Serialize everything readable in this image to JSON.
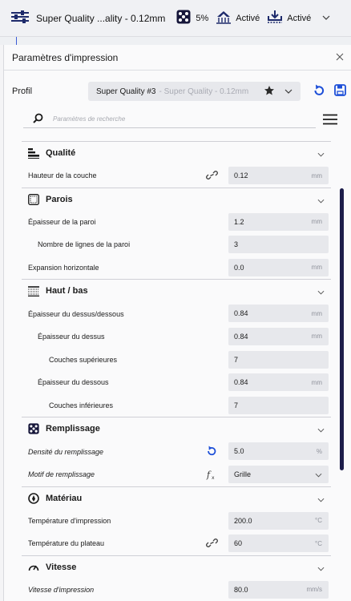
{
  "header": {
    "profile_summary": "Super Quality ...ality - 0.12mm",
    "infill_value": "5%",
    "support_status": "Activé",
    "adhesion_status": "Activé",
    "icons": [
      "settings-sliders-icon",
      "infill-icon",
      "support-icon",
      "adhesion-icon",
      "chevron-down-icon"
    ]
  },
  "panel": {
    "title": "Paramètres d'impression",
    "profile_label": "Profil",
    "profile_name": "Super Quality #3",
    "profile_detail": "- Super Quality - 0.12mm",
    "search_placeholder": "Paramètres de recherche"
  },
  "colors": {
    "accent": "#1d4fd8",
    "scrollbar": "#1c1c4a"
  },
  "sections": [
    {
      "name": "Qualité",
      "icon": "quality-icon",
      "rows": [
        {
          "label": "Hauteur de la couche",
          "value": "0.12",
          "unit": "mm",
          "indent": 0,
          "action": "link-icon"
        }
      ]
    },
    {
      "name": "Parois",
      "icon": "walls-icon",
      "rows": [
        {
          "label": "Épaisseur de la paroi",
          "value": "1.2",
          "unit": "mm",
          "indent": 0
        },
        {
          "label": "Nombre de lignes de la paroi",
          "value": "3",
          "unit": "",
          "indent": 1
        },
        {
          "label": "Expansion horizontale",
          "value": "0.0",
          "unit": "mm",
          "indent": 0
        }
      ]
    },
    {
      "name": "Haut / bas",
      "icon": "top-bottom-icon",
      "rows": [
        {
          "label": "Épaisseur du dessus/dessous",
          "value": "0.84",
          "unit": "mm",
          "indent": 0
        },
        {
          "label": "Épaisseur du dessus",
          "value": "0.84",
          "unit": "mm",
          "indent": 1
        },
        {
          "label": "Couches supérieures",
          "value": "7",
          "unit": "",
          "indent": 2
        },
        {
          "label": "Épaisseur du dessous",
          "value": "0.84",
          "unit": "mm",
          "indent": 1
        },
        {
          "label": "Couches inférieures",
          "value": "7",
          "unit": "",
          "indent": 2
        }
      ]
    },
    {
      "name": "Remplissage",
      "icon": "infill-icon",
      "rows": [
        {
          "label": "Densité du remplissage",
          "value": "5.0",
          "unit": "%",
          "indent": 0,
          "italic": true,
          "action": "reset-icon"
        },
        {
          "label": "Motif de remplissage",
          "value": "Grille",
          "unit": "",
          "indent": 0,
          "italic": true,
          "action": "function-icon",
          "dropdown": true
        }
      ]
    },
    {
      "name": "Matériau",
      "icon": "material-icon",
      "rows": [
        {
          "label": "Température d'impression",
          "value": "200.0",
          "unit": "°C",
          "indent": 0
        },
        {
          "label": "Température du plateau",
          "value": "60",
          "unit": "°C",
          "indent": 0,
          "action": "link-icon"
        }
      ]
    },
    {
      "name": "Vitesse",
      "icon": "speed-icon",
      "rows": [
        {
          "label": "Vitesse d'impression",
          "value": "80.0",
          "unit": "mm/s",
          "indent": 0,
          "italic": true
        }
      ]
    }
  ]
}
